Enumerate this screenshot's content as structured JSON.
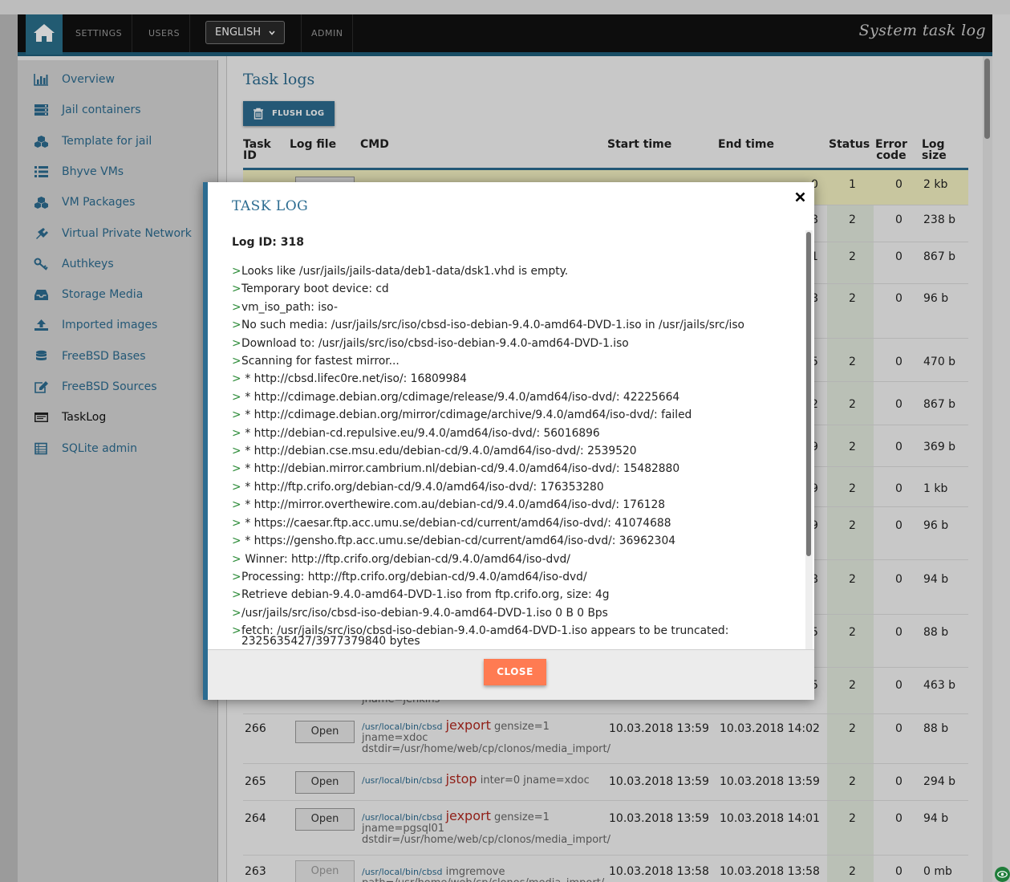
{
  "topbar": {
    "nav": [
      "SETTINGS",
      "USERS",
      "ADMIN"
    ],
    "language": "ENGLISH",
    "page_title": "System task log"
  },
  "sidebar": {
    "items": [
      {
        "label": "Overview",
        "icon": "bar-chart-icon"
      },
      {
        "label": "Jail containers",
        "icon": "server-icon"
      },
      {
        "label": "Template for jail",
        "icon": "cubes-icon"
      },
      {
        "label": "Bhyve VMs",
        "icon": "list-icon"
      },
      {
        "label": "VM Packages",
        "icon": "cubes-icon"
      },
      {
        "label": "Virtual Private Network",
        "icon": "plug-icon"
      },
      {
        "label": "Authkeys",
        "icon": "key-icon"
      },
      {
        "label": "Storage Media",
        "icon": "inbox-icon"
      },
      {
        "label": "Imported images",
        "icon": "upload-icon"
      },
      {
        "label": "FreeBSD Bases",
        "icon": "database-icon"
      },
      {
        "label": "FreeBSD Sources",
        "icon": "edit-icon"
      },
      {
        "label": "TaskLog",
        "icon": "terminal-icon",
        "active": true
      },
      {
        "label": "SQLite admin",
        "icon": "table-icon"
      }
    ]
  },
  "main": {
    "title": "Task logs",
    "flush_label": "FLUSH LOG",
    "columns": {
      "task_id": [
        "Task",
        "ID"
      ],
      "log_file": "Log file",
      "cmd": "CMD",
      "start": "Start time",
      "end": "End time",
      "status": "Status",
      "error": [
        "Error",
        "code"
      ],
      "size": [
        "Log",
        "size"
      ]
    },
    "hidden_rows": [
      {
        "end_tail": "0",
        "status": "1",
        "error": "0",
        "size": "2 kb"
      },
      {
        "end_tail": "8",
        "status": "2",
        "error": "0",
        "size": "238 b"
      },
      {
        "end_tail": "1",
        "status": "2",
        "error": "0",
        "size": "867 b"
      },
      {
        "end_tail": "8",
        "status": "2",
        "error": "0",
        "size": "96 b"
      },
      {
        "end_tail": "5",
        "status": "2",
        "error": "0",
        "size": "470 b"
      },
      {
        "end_tail": "2",
        "status": "2",
        "error": "0",
        "size": "867 b"
      },
      {
        "end_tail": "9",
        "status": "2",
        "error": "0",
        "size": "369 b"
      },
      {
        "end_tail": "9",
        "status": "2",
        "error": "0",
        "size": "1 kb"
      },
      {
        "end_tail": "9",
        "status": "2",
        "error": "0",
        "size": "96 b"
      },
      {
        "end_tail": "8",
        "status": "2",
        "error": "0",
        "size": "94 b"
      },
      {
        "end_tail": "5",
        "status": "2",
        "error": "0",
        "size": "88 b"
      },
      {
        "end_tail": "5",
        "status": "2",
        "error": "0",
        "size": "463 b"
      }
    ],
    "partial_cmd_fragment": "jname=jenkins",
    "rows": [
      {
        "id": "266",
        "open": "Open",
        "path": "/usr/local/bin/cbsd",
        "verb": "jexport",
        "args": "gensize=1 jname=xdoc dstdir=/usr/home/web/cp/clonos/media_import/",
        "start": "10.03.2018 13:59",
        "end": "10.03.2018 14:02",
        "status": "2",
        "error": "0",
        "size": "88 b"
      },
      {
        "id": "265",
        "open": "Open",
        "path": "/usr/local/bin/cbsd",
        "verb": "jstop",
        "args": "inter=0 jname=xdoc",
        "start": "10.03.2018 13:59",
        "end": "10.03.2018 13:59",
        "status": "2",
        "error": "0",
        "size": "294 b"
      },
      {
        "id": "264",
        "open": "Open",
        "path": "/usr/local/bin/cbsd",
        "verb": "jexport",
        "args": "gensize=1 jname=pgsql01 dstdir=/usr/home/web/cp/clonos/media_import/",
        "start": "10.03.2018 13:59",
        "end": "10.03.2018 14:01",
        "status": "2",
        "error": "0",
        "size": "94 b"
      },
      {
        "id": "263",
        "open": "Open",
        "path": "/usr/local/bin/cbsd",
        "verb": "",
        "args": "imgremove path=/usr/home/web/cp/clonos/media_import/",
        "start": "10.03.2018 13:58",
        "end": "10.03.2018 13:58",
        "status": "2",
        "error": "0",
        "size": "0 mb"
      }
    ]
  },
  "modal": {
    "title": "TASK LOG",
    "log_id_label": "Log ID: 318",
    "close_label": "CLOSE",
    "lines": [
      "Looks like /usr/jails/jails-data/deb1-data/dsk1.vhd is empty.",
      "Temporary boot device: cd",
      "vm_iso_path: iso-",
      "No such media: /usr/jails/src/iso/cbsd-iso-debian-9.4.0-amd64-DVD-1.iso in /usr/jails/src/iso",
      "Download to: /usr/jails/src/iso/cbsd-iso-debian-9.4.0-amd64-DVD-1.iso",
      "Scanning for fastest mirror...",
      " * http://cbsd.lifec0re.net/iso/: 16809984",
      " * http://cdimage.debian.org/cdimage/release/9.4.0/amd64/iso-dvd/: 42225664",
      " * http://cdimage.debian.org/mirror/cdimage/archive/9.4.0/amd64/iso-dvd/: failed",
      " * http://debian-cd.repulsive.eu/9.4.0/amd64/iso-dvd/: 56016896",
      " * http://debian.cse.msu.edu/debian-cd/9.4.0/amd64/iso-dvd/: 2539520",
      " * http://debian.mirror.cambrium.nl/debian-cd/9.4.0/amd64/iso-dvd/: 15482880",
      " * http://ftp.crifo.org/debian-cd/9.4.0/amd64/iso-dvd/: 176353280",
      " * http://mirror.overthewire.com.au/debian-cd/9.4.0/amd64/iso-dvd/: 176128",
      " * https://caesar.ftp.acc.umu.se/debian-cd/current/amd64/iso-dvd/: 41074688",
      " * https://gensho.ftp.acc.umu.se/debian-cd/current/amd64/iso-dvd/: 36962304",
      " Winner: http://ftp.crifo.org/debian-cd/9.4.0/amd64/iso-dvd/",
      "Processing: http://ftp.crifo.org/debian-cd/9.4.0/amd64/iso-dvd/",
      "Retrieve debian-9.4.0-amd64-DVD-1.iso from ftp.crifo.org, size: 4g",
      "/usr/jails/src/iso/cbsd-iso-debian-9.4.0-amd64-DVD-1.iso 0 B 0 Bps",
      "fetch: /usr/jails/src/iso/cbsd-iso-debian-9.4.0-amd64-DVD-1.iso appears to be truncated: 2325635427/3977379840 bytes"
    ]
  },
  "colors": {
    "accent": "#2c6c91",
    "danger_verb": "#b0281f",
    "close_button": "#ff7b52",
    "prompt_green": "#2a8a36",
    "highlight_row": "#f4f2c2"
  }
}
